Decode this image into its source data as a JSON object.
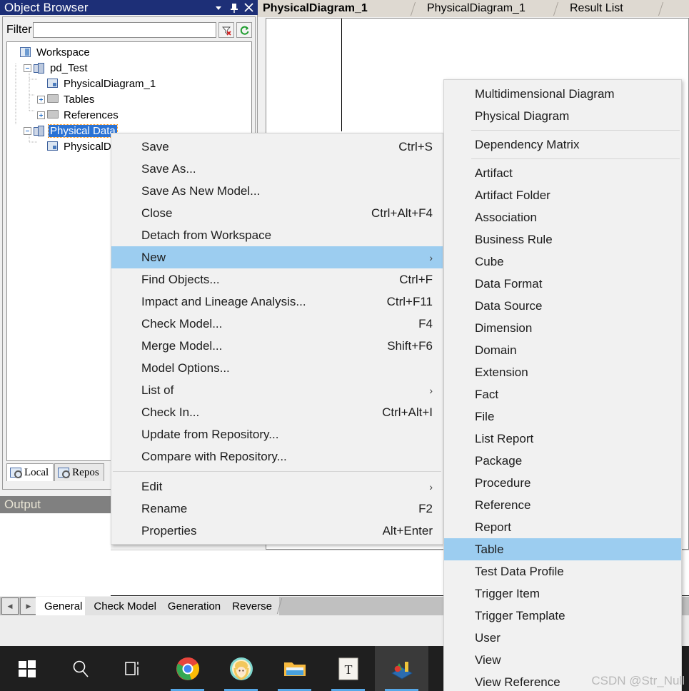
{
  "window": {
    "panel_title": "Object Browser",
    "dropdown_icon": "chevron-down-icon",
    "pin_icon": "pin-icon",
    "close_icon": "close-icon"
  },
  "editor_tabs": [
    {
      "label": "PhysicalDiagram_1",
      "active": true
    },
    {
      "label": "PhysicalDiagram_1",
      "active": false
    },
    {
      "label": "Result List",
      "active": false
    }
  ],
  "filter": {
    "label": "Filter",
    "value": "",
    "placeholder": "",
    "clear_button_icon": "filter-clear-icon",
    "refresh_button_icon": "refresh-icon"
  },
  "tree": [
    {
      "label": "Workspace",
      "icon": "workspace-icon",
      "indent": 0,
      "expander": "none",
      "selected": false
    },
    {
      "label": "pd_Test",
      "icon": "model-icon",
      "indent": 1,
      "expander": "minus",
      "selected": false
    },
    {
      "label": "PhysicalDiagram_1",
      "icon": "diagram-icon",
      "indent": 2,
      "expander": "none",
      "selected": false
    },
    {
      "label": "Tables",
      "icon": "folder-icon",
      "indent": 2,
      "expander": "plus",
      "selected": false
    },
    {
      "label": "References",
      "icon": "folder-icon",
      "indent": 2,
      "expander": "plus",
      "selected": false
    },
    {
      "label": "Physical Data",
      "icon": "model-icon",
      "indent": 1,
      "expander": "minus",
      "selected": true
    },
    {
      "label": "PhysicalDiag",
      "icon": "diagram-icon",
      "indent": 2,
      "expander": "none",
      "selected": false
    }
  ],
  "browser_tabs": [
    {
      "label": "Local",
      "icon": "local-icon",
      "active": true
    },
    {
      "label": "Repos",
      "icon": "repository-icon",
      "active": false
    }
  ],
  "output": {
    "title": "Output",
    "body_text": ""
  },
  "bottom_tabs": {
    "prev_icon": "arrow-left-icon",
    "next_icon": "arrow-right-icon",
    "tabs": [
      {
        "label": "General",
        "active": true
      },
      {
        "label": "Check Model",
        "active": false
      },
      {
        "label": "Generation",
        "active": false
      },
      {
        "label": "Reverse",
        "active": false
      }
    ]
  },
  "context_menu": {
    "items": [
      {
        "type": "item",
        "label": "Save",
        "accel": "Ctrl+S",
        "submenu": false,
        "highlighted": false
      },
      {
        "type": "item",
        "label": "Save As...",
        "accel": "",
        "submenu": false,
        "highlighted": false
      },
      {
        "type": "item",
        "label": "Save As New Model...",
        "accel": "",
        "submenu": false,
        "highlighted": false
      },
      {
        "type": "item",
        "label": "Close",
        "accel": "Ctrl+Alt+F4",
        "submenu": false,
        "highlighted": false
      },
      {
        "type": "item",
        "label": "Detach from Workspace",
        "accel": "",
        "submenu": false,
        "highlighted": false
      },
      {
        "type": "item",
        "label": "New",
        "accel": "",
        "submenu": true,
        "highlighted": true
      },
      {
        "type": "item",
        "label": "Find Objects...",
        "accel": "Ctrl+F",
        "submenu": false,
        "highlighted": false
      },
      {
        "type": "item",
        "label": "Impact and Lineage Analysis...",
        "accel": "Ctrl+F11",
        "submenu": false,
        "highlighted": false
      },
      {
        "type": "item",
        "label": "Check Model...",
        "accel": "F4",
        "submenu": false,
        "highlighted": false
      },
      {
        "type": "item",
        "label": "Merge Model...",
        "accel": "Shift+F6",
        "submenu": false,
        "highlighted": false
      },
      {
        "type": "item",
        "label": "Model Options...",
        "accel": "",
        "submenu": false,
        "highlighted": false
      },
      {
        "type": "item",
        "label": "List of",
        "accel": "",
        "submenu": true,
        "highlighted": false
      },
      {
        "type": "item",
        "label": "Check In...",
        "accel": "Ctrl+Alt+I",
        "submenu": false,
        "highlighted": false
      },
      {
        "type": "item",
        "label": "Update from Repository...",
        "accel": "",
        "submenu": false,
        "highlighted": false
      },
      {
        "type": "item",
        "label": "Compare with Repository...",
        "accel": "",
        "submenu": false,
        "highlighted": false
      },
      {
        "type": "separator"
      },
      {
        "type": "item",
        "label": "Edit",
        "accel": "",
        "submenu": true,
        "highlighted": false
      },
      {
        "type": "item",
        "label": "Rename",
        "accel": "F2",
        "submenu": false,
        "highlighted": false
      },
      {
        "type": "item",
        "label": "Properties",
        "accel": "Alt+Enter",
        "submenu": false,
        "highlighted": false
      }
    ]
  },
  "submenu": {
    "items": [
      {
        "type": "item",
        "label": "Multidimensional Diagram",
        "highlighted": false
      },
      {
        "type": "item",
        "label": "Physical Diagram",
        "highlighted": false
      },
      {
        "type": "separator"
      },
      {
        "type": "item",
        "label": "Dependency Matrix",
        "highlighted": false
      },
      {
        "type": "separator"
      },
      {
        "type": "item",
        "label": "Artifact",
        "highlighted": false
      },
      {
        "type": "item",
        "label": "Artifact Folder",
        "highlighted": false
      },
      {
        "type": "item",
        "label": "Association",
        "highlighted": false
      },
      {
        "type": "item",
        "label": "Business Rule",
        "highlighted": false
      },
      {
        "type": "item",
        "label": "Cube",
        "highlighted": false
      },
      {
        "type": "item",
        "label": "Data Format",
        "highlighted": false
      },
      {
        "type": "item",
        "label": "Data Source",
        "highlighted": false
      },
      {
        "type": "item",
        "label": "Dimension",
        "highlighted": false
      },
      {
        "type": "item",
        "label": "Domain",
        "highlighted": false
      },
      {
        "type": "item",
        "label": "Extension",
        "highlighted": false
      },
      {
        "type": "item",
        "label": "Fact",
        "highlighted": false
      },
      {
        "type": "item",
        "label": "File",
        "highlighted": false
      },
      {
        "type": "item",
        "label": "List Report",
        "highlighted": false
      },
      {
        "type": "item",
        "label": "Package",
        "highlighted": false
      },
      {
        "type": "item",
        "label": "Procedure",
        "highlighted": false
      },
      {
        "type": "item",
        "label": "Reference",
        "highlighted": false
      },
      {
        "type": "item",
        "label": "Report",
        "highlighted": false
      },
      {
        "type": "item",
        "label": "Table",
        "highlighted": true
      },
      {
        "type": "item",
        "label": "Test Data Profile",
        "highlighted": false
      },
      {
        "type": "item",
        "label": "Trigger Item",
        "highlighted": false
      },
      {
        "type": "item",
        "label": "Trigger Template",
        "highlighted": false
      },
      {
        "type": "item",
        "label": "User",
        "highlighted": false
      },
      {
        "type": "item",
        "label": "View",
        "highlighted": false
      },
      {
        "type": "item",
        "label": "View Reference",
        "highlighted": false
      }
    ]
  },
  "watermark": "CSDN @Str_Null",
  "taskbar": {
    "items": [
      {
        "name": "start-button",
        "icon": "windows-logo-icon",
        "running": false,
        "active": false
      },
      {
        "name": "search-button",
        "icon": "search-icon",
        "running": false,
        "active": false
      },
      {
        "name": "task-view-button",
        "icon": "task-view-icon",
        "running": false,
        "active": false
      },
      {
        "name": "chrome-app",
        "icon": "chrome-icon",
        "running": true,
        "active": false
      },
      {
        "name": "avatar-app",
        "icon": "avatar-icon",
        "running": true,
        "active": false
      },
      {
        "name": "file-explorer-app",
        "icon": "folder-icon",
        "running": true,
        "active": false
      },
      {
        "name": "text-app",
        "icon": "letter-t-icon",
        "running": true,
        "active": false
      },
      {
        "name": "powerdesigner-app",
        "icon": "powerdesigner-icon",
        "running": true,
        "active": true
      }
    ]
  },
  "colors": {
    "titlebar": "#1d2f77",
    "tree_selection": "#2a72d4",
    "menu_highlight": "#9ccdf0",
    "menu_bg": "#f1f1f1",
    "taskbar": "#1f1f1f",
    "accent_underline": "#57a8e8"
  }
}
